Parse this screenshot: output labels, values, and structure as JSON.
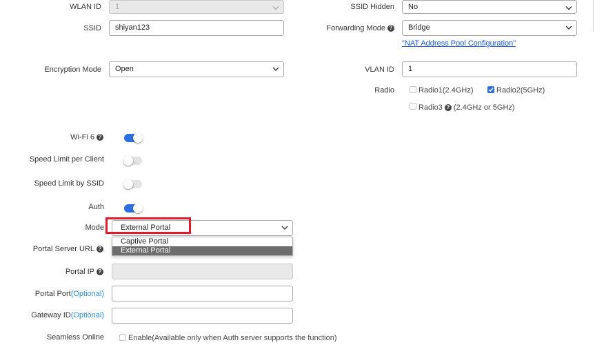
{
  "wlan_id": {
    "label": "WLAN ID",
    "value": "1"
  },
  "ssid_hidden": {
    "label": "SSID Hidden",
    "value": "No"
  },
  "ssid": {
    "label": "SSID",
    "value": "shiyan123"
  },
  "forwarding_mode": {
    "label": "Forwarding Mode",
    "value": "Bridge"
  },
  "nat_link": "\"NAT Address Pool Configuration\"",
  "encryption_mode": {
    "label": "Encryption Mode",
    "value": "Open"
  },
  "vlan_id": {
    "label": "VLAN ID",
    "value": "1"
  },
  "radio": {
    "label": "Radio",
    "radio1": "Radio1(2.4GHz)",
    "radio2": "Radio2(5GHz)",
    "radio3": "Radio3",
    "radio3_note": "(2.4GHz or 5GHz)"
  },
  "wifi6": {
    "label": "Wi-Fi 6",
    "state": "on"
  },
  "speed_limit_client": {
    "label": "Speed Limit per Client",
    "state": "off"
  },
  "speed_limit_ssid": {
    "label": "Speed Limit by SSID",
    "state": "off"
  },
  "auth": {
    "label": "Auth",
    "state": "on"
  },
  "mode": {
    "label": "Mode",
    "value": "External Portal",
    "options": [
      "Captive Portal",
      "External Portal"
    ]
  },
  "portal_server_url": {
    "label": "Portal Server URL"
  },
  "portal_ip": {
    "label": "Portal IP"
  },
  "portal_port": {
    "label": "Portal Port",
    "optional": "(Optional)"
  },
  "gateway_id": {
    "label": "Gateway ID",
    "optional": "(Optional)"
  },
  "seamless": {
    "label": "Seamless Online",
    "text": "Enable(Available only when Auth server supports the function)"
  },
  "help_glyph": "?",
  "colors": {
    "accent": "#2f6ee0",
    "highlight": "#e01c2a",
    "link": "#1a56d6",
    "optional": "#2f8fd8"
  }
}
